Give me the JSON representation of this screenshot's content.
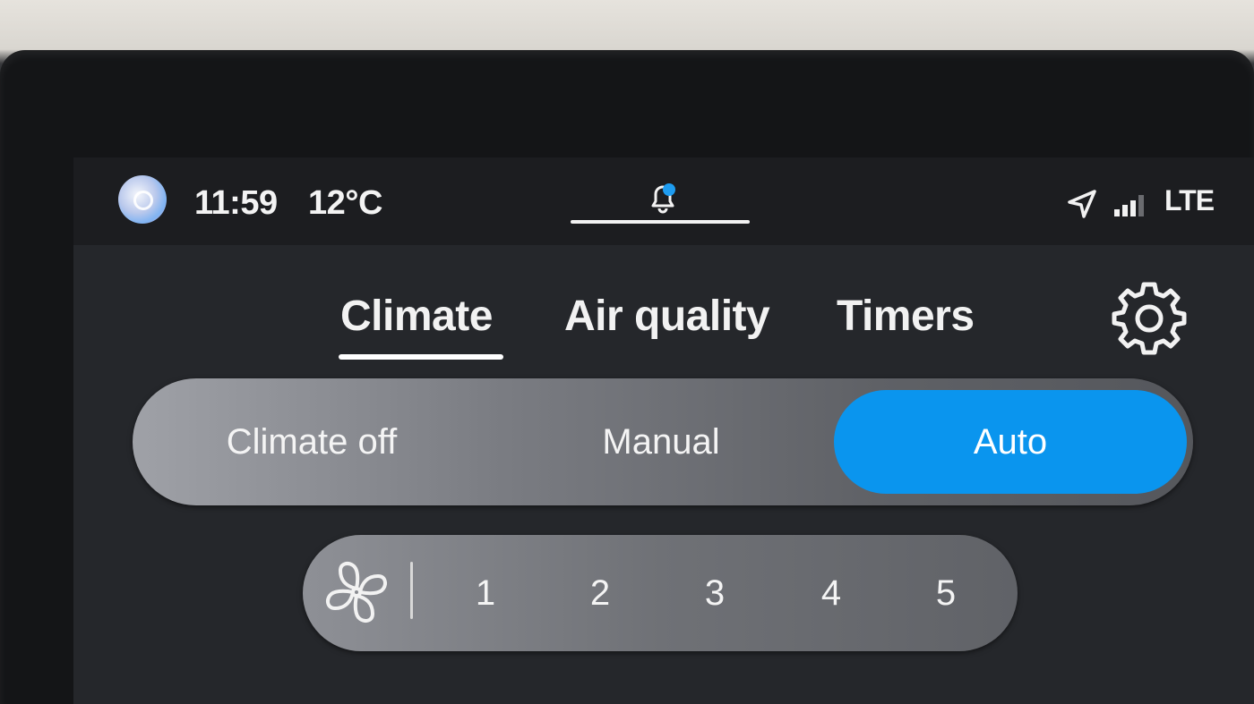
{
  "status_bar": {
    "time": "11:59",
    "temperature": "12°C",
    "network": "LTE",
    "icons": [
      "app-logo",
      "bell-icon",
      "location-arrow-icon",
      "signal-bars-icon"
    ],
    "notification_dot_color": "#1e9cf0"
  },
  "tabs": [
    {
      "label": "Climate",
      "active": true
    },
    {
      "label": "Air quality",
      "active": false
    },
    {
      "label": "Timers",
      "active": false
    }
  ],
  "settings_icon": "gear-icon",
  "climate_mode": {
    "options": [
      "Climate off",
      "Manual",
      "Auto"
    ],
    "selected": "Auto",
    "accent_color": "#0a95ee"
  },
  "fan_speed": {
    "icon": "fan-icon",
    "levels": [
      "1",
      "2",
      "3",
      "4",
      "5"
    ]
  }
}
